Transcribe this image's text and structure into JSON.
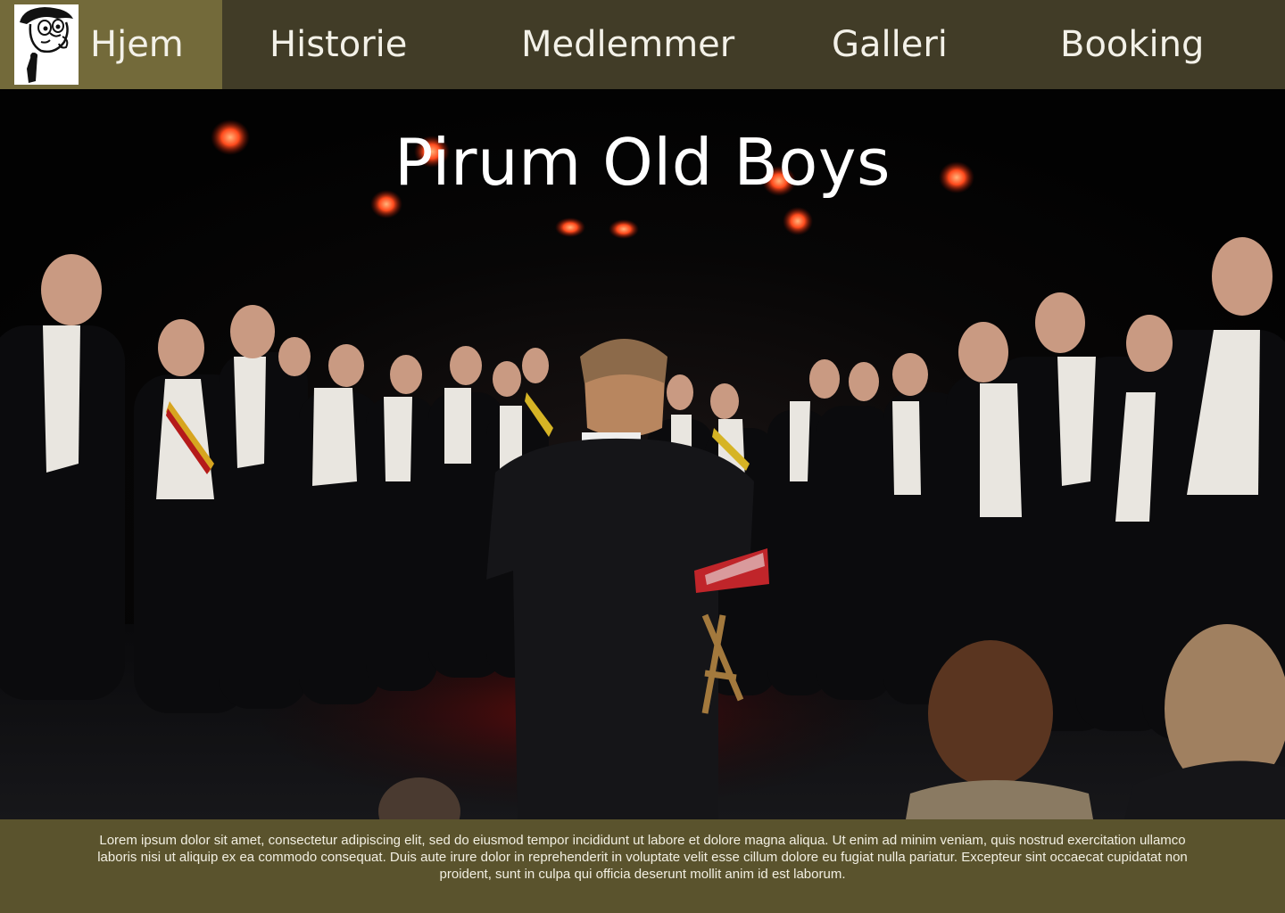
{
  "nav": {
    "items": [
      {
        "label": "Hjem"
      },
      {
        "label": "Historie"
      },
      {
        "label": "Medlemmer"
      },
      {
        "label": "Galleri"
      },
      {
        "label": "Booking"
      }
    ]
  },
  "hero": {
    "title": "Pirum Old Boys"
  },
  "footer": {
    "text": "Lorem ipsum dolor sit amet, consectetur adipiscing elit, sed do eiusmod tempor incididunt ut labore et dolore magna aliqua. Ut enim ad minim veniam, quis nostrud exercitation ullamco laboris nisi ut aliquip ex ea commodo consequat. Duis aute irure dolor in reprehenderit in voluptate velit esse cillum dolore eu fugiat nulla pariatur. Excepteur sint occaecat cupidatat non proident, sunt in culpa qui officia deserunt mollit anim id est laborum."
  },
  "colors": {
    "nav_bg": "#413c27",
    "nav_active_bg": "#736a3a",
    "footer_bg": "#5a532d",
    "stage_light": "#ff3b1f"
  },
  "icons": {
    "logo": "cartoon-character-logo-icon"
  }
}
